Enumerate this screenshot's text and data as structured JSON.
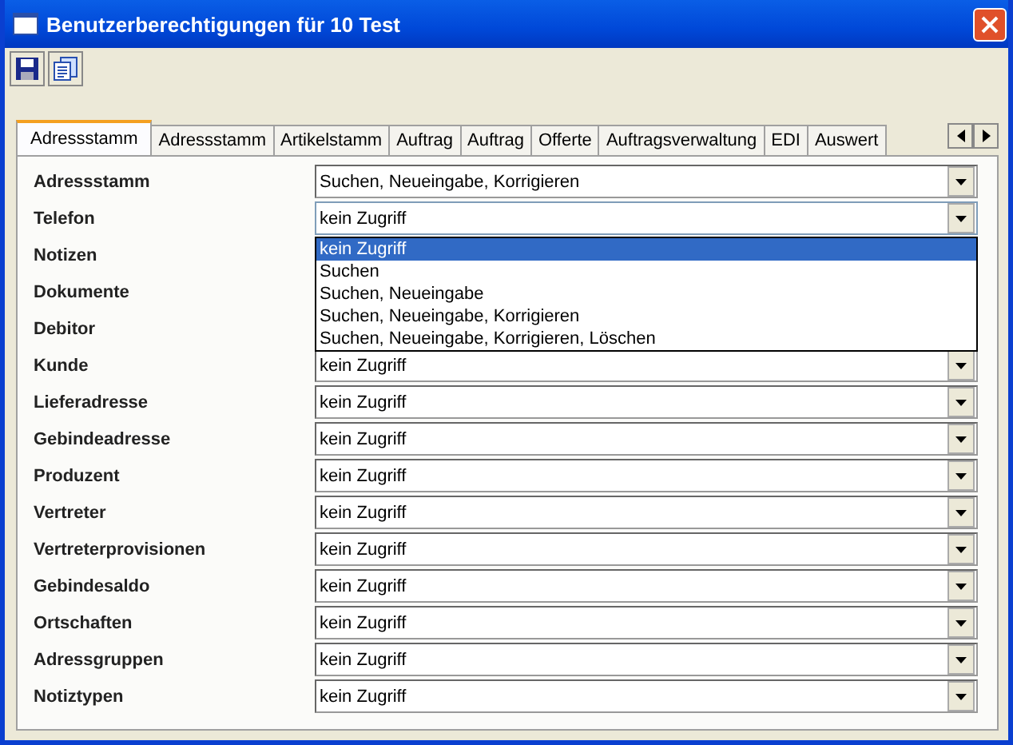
{
  "window": {
    "title": "Benutzerberechtigungen für 10 Test"
  },
  "tabs": [
    {
      "label": "Adressstamm",
      "selected": true
    },
    {
      "label": "Adressstamm",
      "selected": false
    },
    {
      "label": "Artikelstamm",
      "selected": false
    },
    {
      "label": "Auftrag",
      "selected": false
    },
    {
      "label": "Auftrag",
      "selected": false
    },
    {
      "label": "Offerte",
      "selected": false
    },
    {
      "label": "Auftragsverwaltung",
      "selected": false
    },
    {
      "label": "EDI",
      "selected": false
    },
    {
      "label": "Auswert",
      "selected": false
    }
  ],
  "rows": [
    {
      "label": "Adressstamm",
      "value": "Suchen, Neueingabe, Korrigieren"
    },
    {
      "label": "Telefon",
      "value": "kein Zugriff",
      "expanded": true,
      "options": [
        {
          "label": "kein Zugriff",
          "selected": true
        },
        {
          "label": "Suchen",
          "selected": false
        },
        {
          "label": "Suchen, Neueingabe",
          "selected": false
        },
        {
          "label": "Suchen, Neueingabe, Korrigieren",
          "selected": false
        },
        {
          "label": "Suchen, Neueingabe, Korrigieren, Löschen",
          "selected": false
        }
      ]
    },
    {
      "label": "Notizen"
    },
    {
      "label": "Dokumente"
    },
    {
      "label": "Debitor"
    },
    {
      "label": "Kunde",
      "value": "kein Zugriff"
    },
    {
      "label": "Lieferadresse",
      "value": "kein Zugriff"
    },
    {
      "label": "Gebindeadresse",
      "value": "kein Zugriff"
    },
    {
      "label": "Produzent",
      "value": "kein Zugriff"
    },
    {
      "label": "Vertreter",
      "value": "kein Zugriff"
    },
    {
      "label": "Vertreterprovisionen",
      "value": "kein Zugriff"
    },
    {
      "label": "Gebindesaldo",
      "value": "kein Zugriff"
    },
    {
      "label": "Ortschaften",
      "value": "kein Zugriff"
    },
    {
      "label": "Adressgruppen",
      "value": "kein Zugriff"
    },
    {
      "label": "Notiztypen",
      "value": "kein Zugriff"
    }
  ]
}
